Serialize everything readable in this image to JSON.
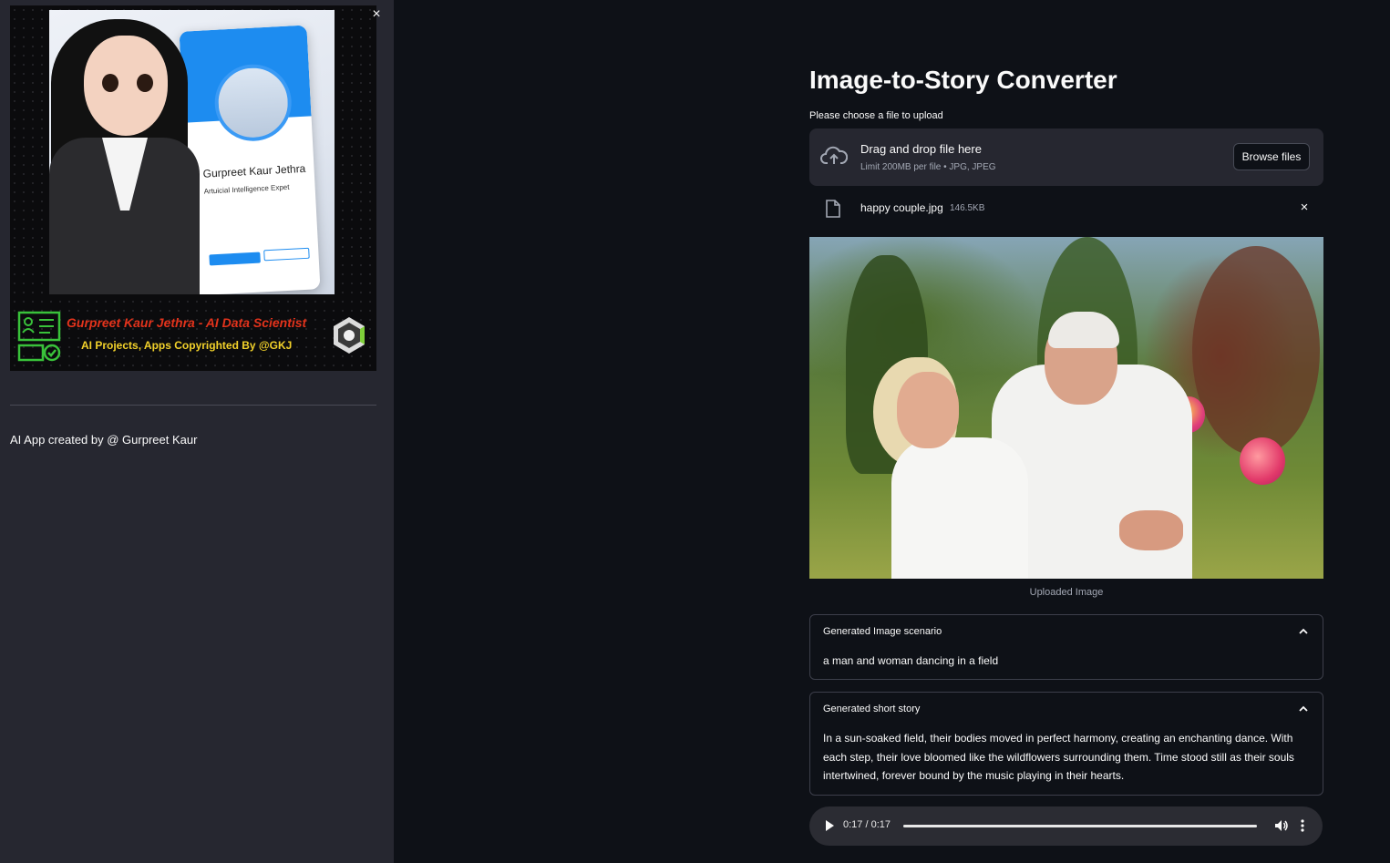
{
  "sidebar": {
    "close_icon": "×",
    "banner": {
      "card_name": "Gurpreet Kaur Jethra",
      "card_title": "Artuicial Intelligence Expet",
      "line1": "Gurpreet Kaur Jethra - AI Data Scientist",
      "line2": "AI Projects, Apps Copyrighted By @GKJ"
    },
    "credit": "AI App created by @ Gurpreet Kaur"
  },
  "main": {
    "title": "Image-to-Story Converter",
    "uploader": {
      "label": "Please choose a file to upload",
      "drop_title": "Drag and drop file here",
      "drop_limit": "Limit 200MB per file • JPG, JPEG",
      "browse_label": "Browse files"
    },
    "file": {
      "name": "happy couple.jpg",
      "size": "146.5KB",
      "remove_icon": "×"
    },
    "image_caption": "Uploaded Image",
    "scenario": {
      "header": "Generated Image scenario",
      "text": "a man and woman dancing in a field"
    },
    "story": {
      "header": "Generated short story",
      "text": "In a sun-soaked field, their bodies moved in perfect harmony, creating an enchanting dance. With each step, their love bloomed like the wildflowers surrounding them. Time stood still as their souls intertwined, forever bound by the music playing in their hearts."
    },
    "audio": {
      "time": "0:17 / 0:17",
      "progress": 1.0
    }
  },
  "colors": {
    "background": "#0e1117",
    "sidebar": "#262730",
    "banner_red": "#e2331c",
    "banner_yellow": "#f2d12a",
    "linkedin_blue": "#1d8cf0"
  }
}
